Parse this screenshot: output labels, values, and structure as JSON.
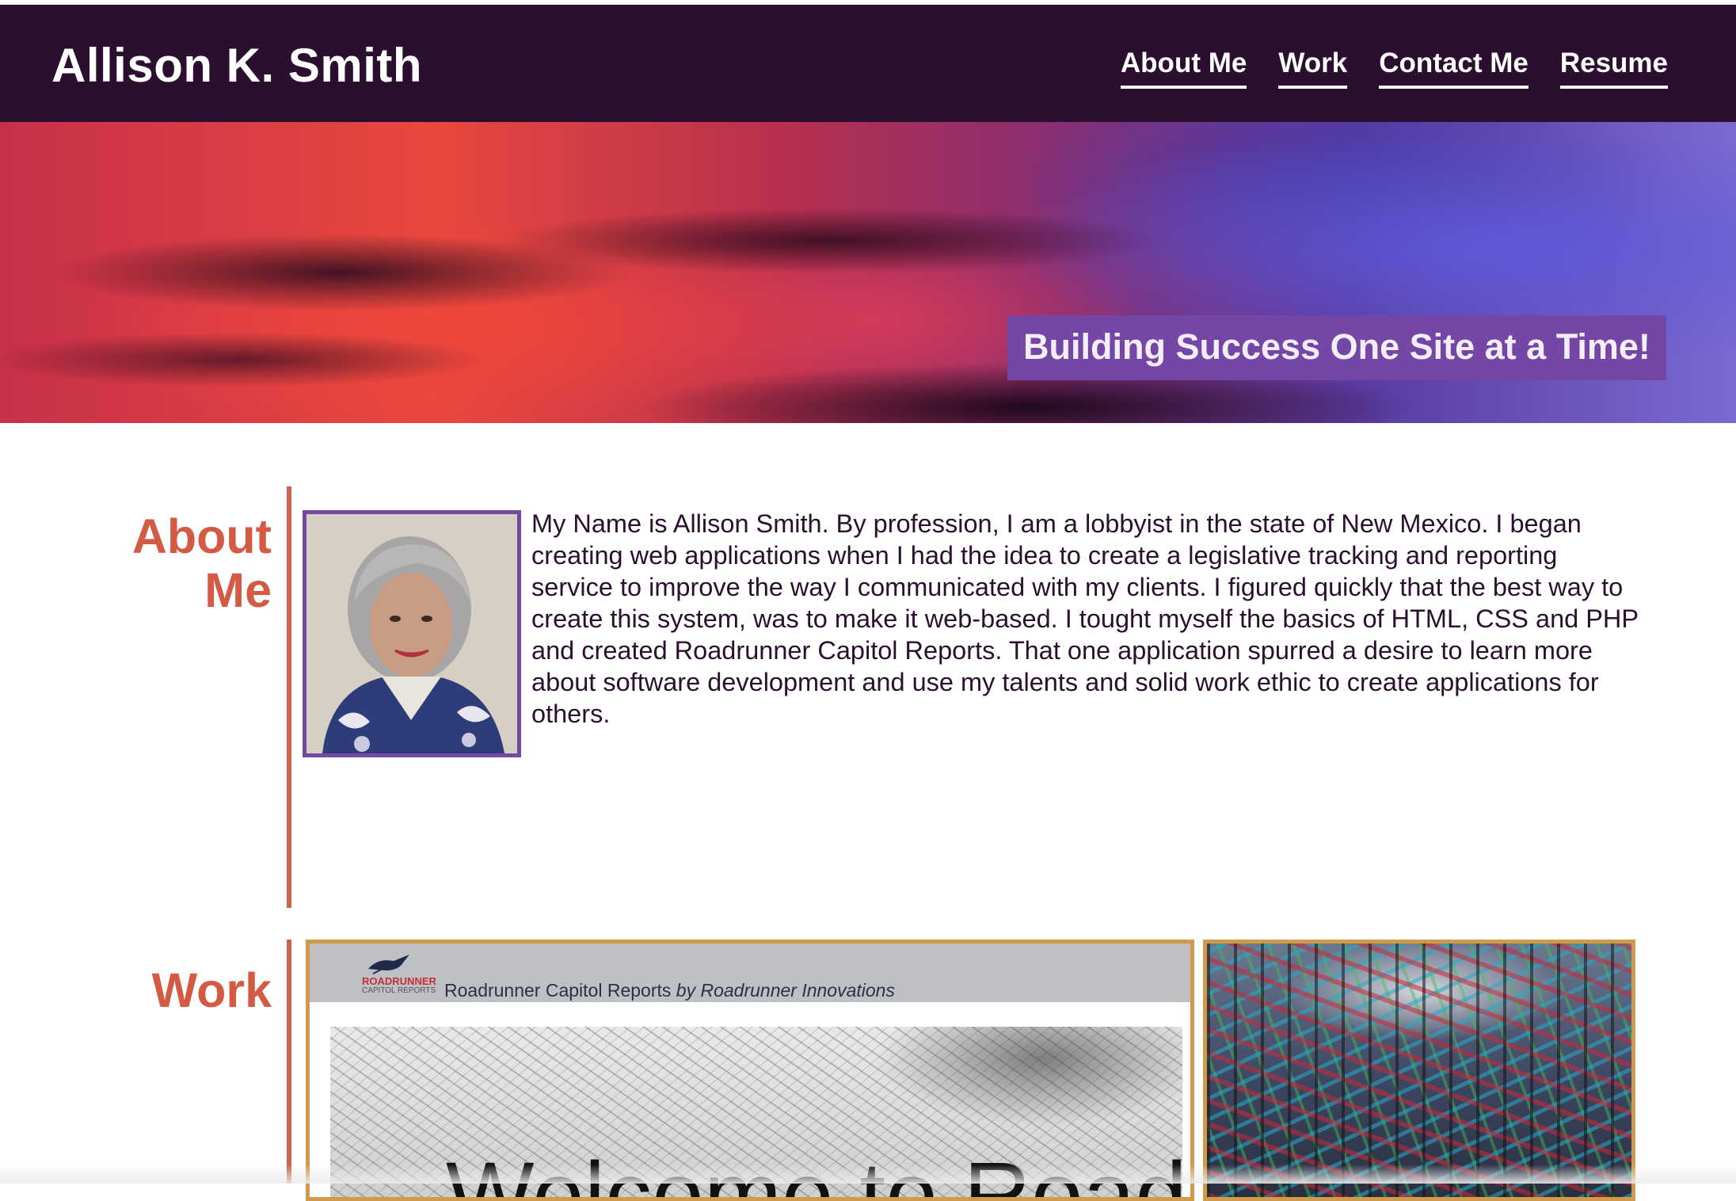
{
  "header": {
    "site_title": "Allison K. Smith",
    "nav": [
      "About Me",
      "Work",
      "Contact Me",
      "Resume"
    ]
  },
  "hero": {
    "tagline": "Building Success One Site at a Time!"
  },
  "about": {
    "heading_line1": "About",
    "heading_line2": "Me",
    "bio": "My Name is Allison Smith. By profession, I am a lobbyist in the state of New Mexico. I began creating web applications when I had the idea to create a legislative tracking and reporting service to improve the way I communicated with my clients. I figured quickly that the best way to create this system, was to make it web-based. I tought myself the basics of HTML, CSS and PHP and created Roadrunner Capitol Reports. That one application spurred a desire to learn more about software development and use my talents and solid work ethic to create applications for others."
  },
  "work": {
    "heading": "Work",
    "project1": {
      "logo_line1": "ROADRUNNER",
      "logo_line2": "CAPITOL REPORTS",
      "title": "Roadrunner Capitol Reports",
      "byline": "by Roadrunner Innovations",
      "welcome": "Welcome to Roadru"
    }
  },
  "colors": {
    "header_bg": "#2b0f2f",
    "accent_purple": "#7447a6",
    "accent_red": "#d45a44",
    "card_border": "#d19a4b"
  }
}
